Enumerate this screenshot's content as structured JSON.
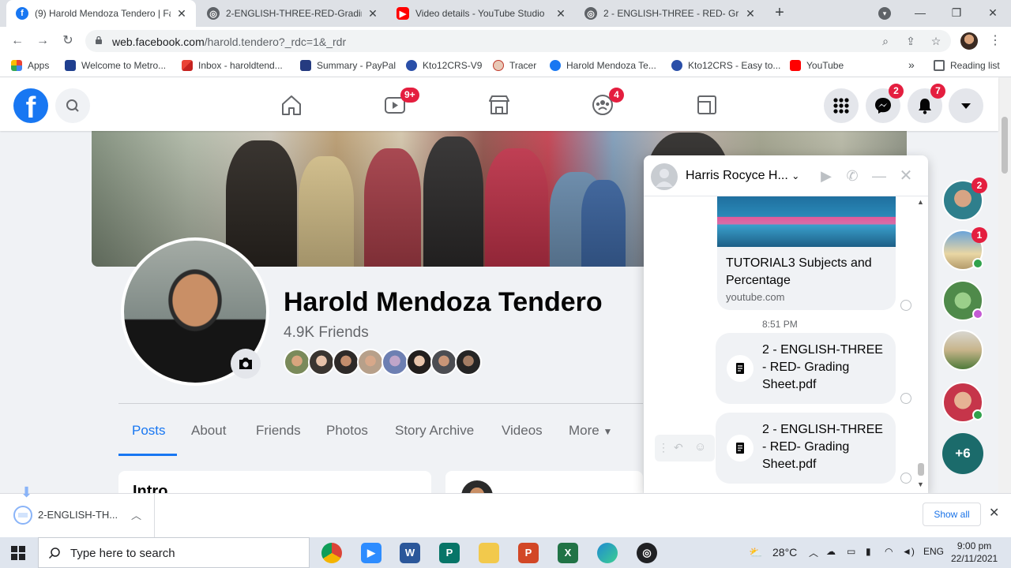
{
  "browser": {
    "tabs": [
      {
        "title": "(9) Harold Mendoza Tendero | Fa",
        "active": true,
        "favicon": "facebook-icon"
      },
      {
        "title": "2-ENGLISH-THREE-RED-Grading",
        "active": false,
        "favicon": "globe-icon"
      },
      {
        "title": "Video details - YouTube Studio",
        "active": false,
        "favicon": "youtube-icon"
      },
      {
        "title": "2 - ENGLISH-THREE - RED- Grad",
        "active": false,
        "favicon": "globe-icon"
      }
    ],
    "url_host": "web.facebook.com",
    "url_rest": "/harold.tendero?_rdc=1&_rdr",
    "bookmarks": [
      {
        "label": "Apps",
        "icon": "apps-grid-icon"
      },
      {
        "label": "Welcome to Metro...",
        "icon": "metrobank-icon"
      },
      {
        "label": "Inbox - haroldtend...",
        "icon": "gmail-icon"
      },
      {
        "label": "Summary - PayPal",
        "icon": "paypal-icon"
      },
      {
        "label": "Kto12CRS-V9",
        "icon": "kto12-icon"
      },
      {
        "label": "Tracer",
        "icon": "tracer-icon"
      },
      {
        "label": "Harold Mendoza Te...",
        "icon": "facebook-icon"
      },
      {
        "label": "Kto12CRS - Easy to...",
        "icon": "kto12-icon"
      },
      {
        "label": "YouTube",
        "icon": "youtube-icon"
      }
    ],
    "bookmarks_overflow": "»",
    "reading_list": "Reading list"
  },
  "facebook": {
    "badges": {
      "watch": "9+",
      "groups": "4",
      "messenger": "2",
      "notifications": "7"
    },
    "profile": {
      "name": "Harold Mendoza Tendero",
      "friends": "4.9K Friends"
    },
    "profile_tabs": [
      {
        "label": "Posts",
        "active": true
      },
      {
        "label": "About"
      },
      {
        "label": "Friends"
      },
      {
        "label": "Photos"
      },
      {
        "label": "Story Archive"
      },
      {
        "label": "Videos"
      },
      {
        "label": "More"
      }
    ],
    "intro_heading": "Intro",
    "colors": {
      "brand": "#1877f2",
      "badge": "#e41e3f"
    }
  },
  "chat": {
    "contact_name": "Harris Rocyce H...",
    "link_title": "TUTORIAL3 Subjects and Percentage",
    "link_domain": "youtube.com",
    "timestamp": "8:51 PM",
    "files": [
      {
        "name": "2 - ENGLISH-THREE - RED- Grading Sheet.pdf"
      },
      {
        "name": "2 - ENGLISH-THREE - RED- Grading Sheet.pdf"
      }
    ]
  },
  "contacts": {
    "badges": [
      "2",
      "1"
    ],
    "more_label": "+6"
  },
  "downloads": {
    "item_name": "2-ENGLISH-TH...",
    "show_all": "Show all"
  },
  "taskbar": {
    "search_placeholder": "Type here to search",
    "temperature": "28°C",
    "language": "ENG",
    "time": "9:00 pm",
    "date": "22/11/2021"
  }
}
